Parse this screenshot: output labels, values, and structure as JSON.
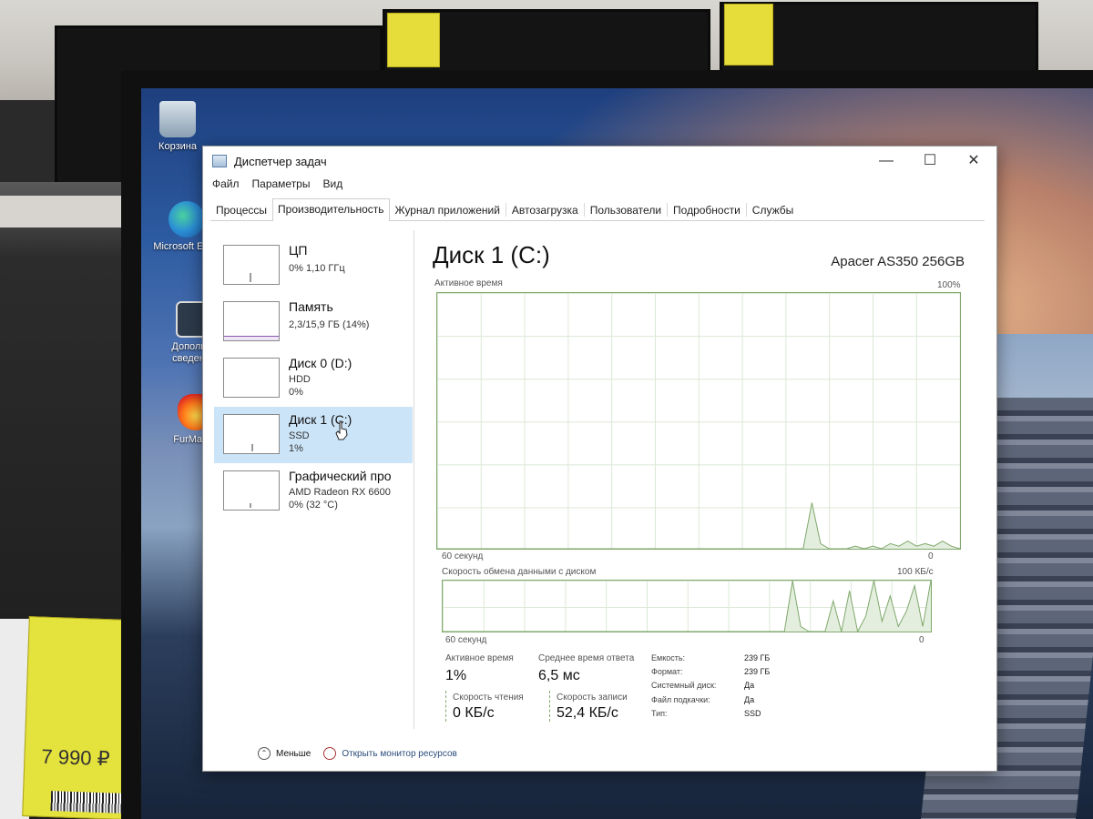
{
  "window": {
    "title": "Диспетчер задач",
    "controls": {
      "minimize": "—",
      "maximize": "☐",
      "close": "✕"
    }
  },
  "menu": [
    "Файл",
    "Параметры",
    "Вид"
  ],
  "tabs": [
    "Процессы",
    "Производительность",
    "Журнал приложений",
    "Автозагрузка",
    "Пользователи",
    "Подробности",
    "Службы"
  ],
  "active_tab": "Производительность",
  "desktop": {
    "icons": [
      {
        "label": "Корзина",
        "icon": "recycle-bin-icon"
      },
      {
        "label": "Microsoft Edge",
        "icon": "edge-icon"
      },
      {
        "label": "Дополнит сведения",
        "icon": "info-icon"
      },
      {
        "label": "FurMark x",
        "icon": "furmark-icon"
      }
    ],
    "price_tag": "7 990 ₽"
  },
  "sidebar": {
    "items": [
      {
        "name": "ЦП",
        "line1": "0% 1,10 ГГц",
        "line2": ""
      },
      {
        "name": "Память",
        "line1": "2,3/15,9 ГБ (14%)",
        "line2": ""
      },
      {
        "name": "Диск 0 (D:)",
        "line1": "HDD",
        "line2": "0%"
      },
      {
        "name": "Диск 1 (C:)",
        "line1": "SSD",
        "line2": "1%"
      },
      {
        "name": "Графический про",
        "line1": "AMD Radeon RX 6600",
        "line2": "0% (32 °C)"
      }
    ],
    "selected_index": 3
  },
  "main": {
    "title": "Диск 1 (C:)",
    "model": "Apacer AS350 256GB",
    "graph1": {
      "label": "Активное время",
      "max_label": "100%",
      "x_left": "60 секунд",
      "x_right": "0",
      "values": [
        0,
        0,
        0,
        0,
        0,
        0,
        0,
        0,
        0,
        0,
        0,
        0,
        0,
        0,
        0,
        0,
        0,
        0,
        0,
        0,
        0,
        0,
        0,
        0,
        0,
        0,
        0,
        0,
        0,
        0,
        0,
        0,
        0,
        0,
        0,
        0,
        0,
        0,
        0,
        0,
        0,
        0,
        0,
        18,
        2,
        0,
        0,
        0,
        1,
        0,
        1,
        0,
        2,
        1,
        3,
        1,
        2,
        1,
        3,
        1,
        0
      ]
    },
    "graph2": {
      "label": "Скорость обмена данными с диском",
      "max_label": "100 КБ/с",
      "x_left": "60 секунд",
      "x_right": "0",
      "values": [
        0,
        0,
        0,
        0,
        0,
        0,
        0,
        0,
        0,
        0,
        0,
        0,
        0,
        0,
        0,
        0,
        0,
        0,
        0,
        0,
        0,
        0,
        0,
        0,
        0,
        0,
        0,
        0,
        0,
        0,
        0,
        0,
        0,
        0,
        0,
        0,
        0,
        0,
        0,
        0,
        0,
        0,
        0,
        100,
        10,
        0,
        0,
        0,
        60,
        0,
        80,
        0,
        30,
        100,
        20,
        70,
        10,
        40,
        90,
        10,
        100
      ]
    },
    "stats": {
      "active_time_label": "Активное время",
      "active_time": "1%",
      "response_label": "Среднее время ответа",
      "response": "6,5 мс",
      "read_label": "Скорость чтения",
      "read": "0 КБ/с",
      "write_label": "Скорость записи",
      "write": "52,4 КБ/с"
    },
    "properties": [
      {
        "key": "Емкость:",
        "value": "239 ГБ"
      },
      {
        "key": "Формат:",
        "value": "239 ГБ"
      },
      {
        "key": "Системный диск:",
        "value": "Да"
      },
      {
        "key": "Файл подкачки:",
        "value": "Да"
      },
      {
        "key": "Тип:",
        "value": "SSD"
      }
    ]
  },
  "footer": {
    "less": "Меньше",
    "monitor": "Открыть монитор ресурсов"
  },
  "colors": {
    "disk_line": "#7fa86b",
    "disk_fill": "#e4eedf",
    "selected": "#cce4f7"
  }
}
